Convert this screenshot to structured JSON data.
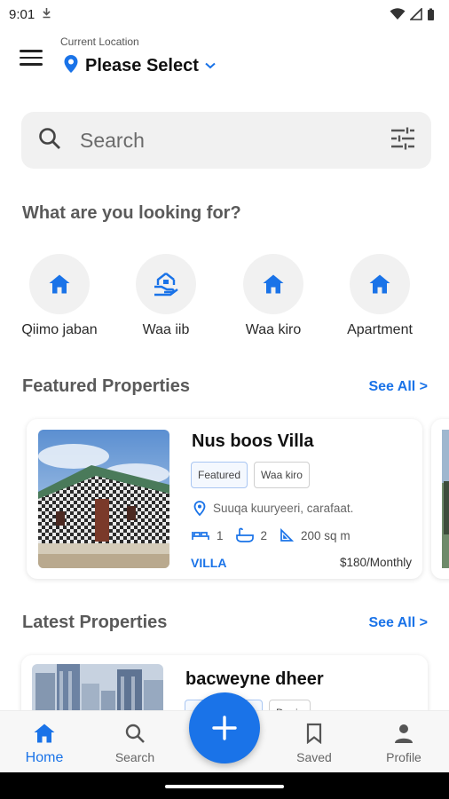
{
  "status_bar": {
    "time": "9:01"
  },
  "header": {
    "location_caption": "Current Location",
    "location_value": "Please Select"
  },
  "search": {
    "placeholder": "Search"
  },
  "categories_section": {
    "title": "What are you looking for?",
    "items": [
      {
        "label": "Qiimo jaban",
        "icon": "home-icon"
      },
      {
        "label": "Waa iib",
        "icon": "hand-home-icon"
      },
      {
        "label": "Waa kiro",
        "icon": "home-icon"
      },
      {
        "label": "Apartment",
        "icon": "home-icon"
      }
    ]
  },
  "featured": {
    "title": "Featured Properties",
    "see_all": "See All >",
    "card": {
      "name": "Nus boos Villa",
      "tags": [
        "Featured",
        "Waa kiro"
      ],
      "address": "Suuqa kuuryeeri, carafaat.",
      "beds": "1",
      "baths": "2",
      "area": "200 sq m",
      "type": "VILLA",
      "price": "$180/Monthly"
    }
  },
  "latest": {
    "title": "Latest Properties",
    "see_all": "See All >",
    "card": {
      "name": "bacweyne dheer",
      "tags": [
        "",
        "Degis"
      ]
    }
  },
  "bottom_nav": {
    "items": [
      {
        "label": "Home",
        "icon": "home-icon",
        "active": true
      },
      {
        "label": "Search",
        "icon": "search-icon",
        "active": false
      },
      {
        "label": "Saved",
        "icon": "bookmark-icon",
        "active": false
      },
      {
        "label": "Profile",
        "icon": "person-icon",
        "active": false
      }
    ]
  },
  "colors": {
    "accent": "#1a73e8",
    "surface": "#f1f1f1",
    "section_title": "#5a5a5a"
  }
}
